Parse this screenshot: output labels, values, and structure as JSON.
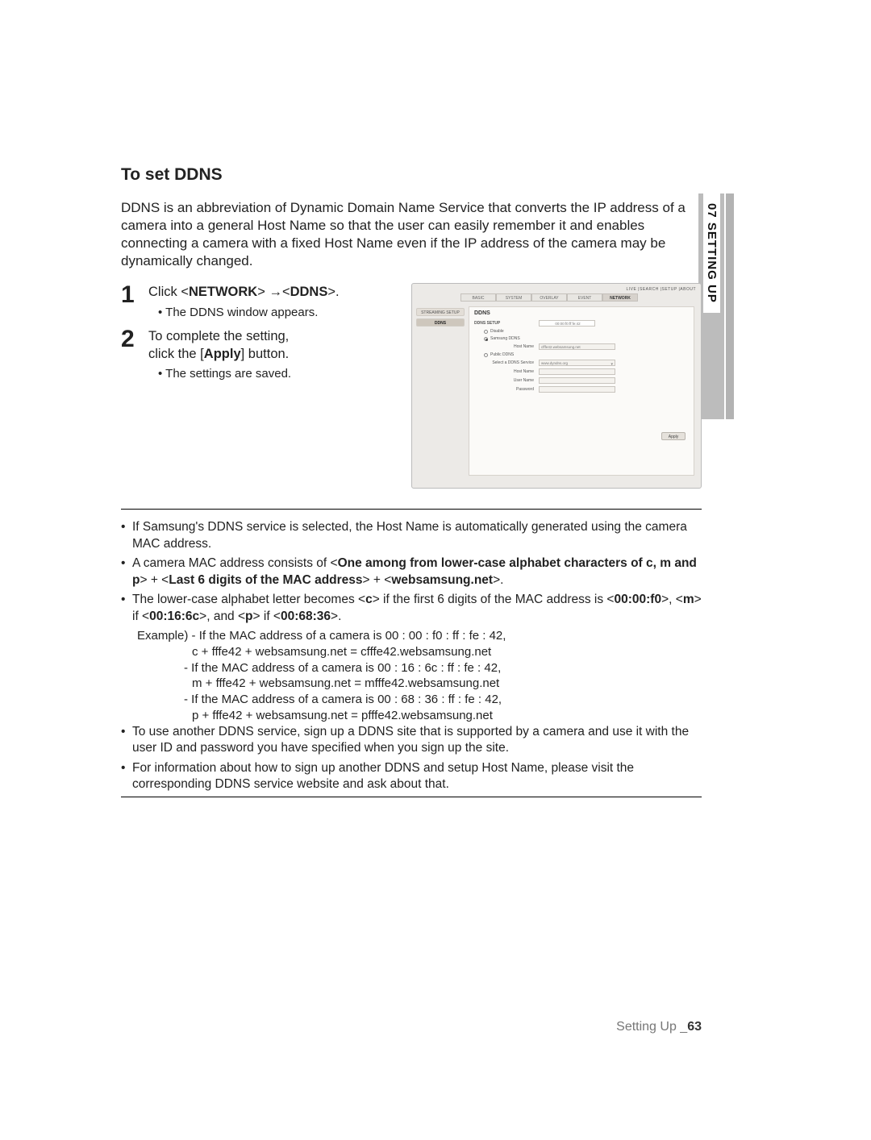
{
  "section_title": "To set DDNS",
  "intro": "DDNS is an abbreviation of Dynamic Domain Name Service that converts the IP address of a camera into a general Host Name so that the user can easily remember it and enables connecting a camera with a fixed Host Name even if the IP address of the camera may be dynamically changed.",
  "side_tab": "07 SETTING UP",
  "steps": [
    {
      "num": "1",
      "pre": "Click <",
      "bold1": "NETWORK",
      "mid": ">",
      "bold2": "DDNS",
      "post": ">.",
      "sub": "The DDNS window appears."
    },
    {
      "num": "2",
      "line1": "To complete the setting,",
      "line2a": "click the [",
      "bold": "Apply",
      "line2b": "] button.",
      "sub": "The settings are saved."
    }
  ],
  "figure": {
    "topnav": "LIVE  |SEARCH |SETUP  |ABOUT",
    "tabs": [
      "BASIC",
      "SYSTEM",
      "OVERLAY",
      "EVENT",
      "NETWORK"
    ],
    "side_items": [
      "STREAMING SETUP",
      "DDNS"
    ],
    "panel_title": "DDNS",
    "mac": "00:00:f0:ff:fe:42",
    "rows": {
      "setup_label": "DDNS SETUP",
      "opt_disable": "Disable",
      "opt_samsung": "Samsung DDNS",
      "hostname_label": "Host Name",
      "hostname_value": "cfffe42.websamsung.net",
      "opt_public": "Public DDNS",
      "select_label": "Select a DDNS Service",
      "select_value": "www.dyndns.org",
      "hostname2_label": "Host Name",
      "username_label": "User Name",
      "password_label": "Password"
    },
    "apply": "Apply"
  },
  "notes": [
    {
      "text": "If Samsung's DDNS service is selected, the Host Name is automatically generated using the camera MAC address."
    },
    {
      "pre": "A camera MAC address consists of <",
      "b1": "One among from lower-case alphabet characters of c, m and p",
      "mid1": "> + <",
      "b2": "Last 6 digits of the MAC address",
      "mid2": "> + <",
      "b3": "websamsung.net",
      "post": ">."
    },
    {
      "pre": "The lower-case alphabet letter becomes <",
      "b1": "c",
      "mid1": "> if the first 6 digits of the MAC address is <",
      "b2": "00:00:f0",
      "mid2": ">, <",
      "b3": "m",
      "mid3": "> if <",
      "b4": "00:16:6c",
      "mid4": ">, and <",
      "b5": "p",
      "mid5": "> if <",
      "b6": "00:68:36",
      "post": ">."
    }
  ],
  "example": {
    "label": "Example)",
    "lines": [
      "- If the MAC address of a camera is 00 : 00 : f0 : ff : fe : 42,",
      "c + fffe42 + websamsung.net = cfffe42.websamsung.net",
      "- If the MAC address of a camera is 00 : 16 : 6c : ff : fe : 42,",
      "m + fffe42 + websamsung.net = mfffe42.websamsung.net",
      "- If the MAC address of a camera is 00 : 68 : 36 : ff : fe : 42,",
      "p + fffe42 + websamsung.net = pfffe42.websamsung.net"
    ]
  },
  "notes2": [
    "To use another DDNS service, sign up a DDNS site that is supported by a camera and use it with the user ID and password you have specified when you sign up the site.",
    "For information about how to sign up another DDNS and setup Host Name, please visit the corresponding DDNS service website and ask about that."
  ],
  "footer": {
    "label": "Setting Up _",
    "page": "63"
  }
}
